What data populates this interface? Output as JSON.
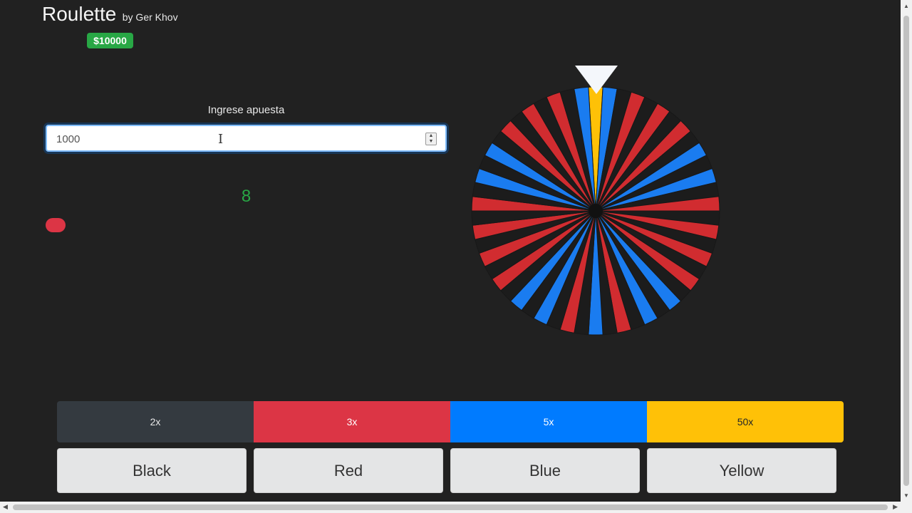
{
  "app": {
    "title": "Roulette",
    "byline": "by Ger Khov",
    "balance": "$10000"
  },
  "bet": {
    "label": "Ingrese apuesta",
    "value": "1000"
  },
  "result": {
    "number": "8"
  },
  "wheel": {
    "segments": 54,
    "colors": {
      "black": "#1c1c1c",
      "red": "#d12c30",
      "blue": "#1a7cf0",
      "yellow": "#fec107"
    }
  },
  "payouts": [
    {
      "label": "2x",
      "color": "#343a40"
    },
    {
      "label": "3x",
      "color": "#dc3545"
    },
    {
      "label": "5x",
      "color": "#007bff"
    },
    {
      "label": "50x",
      "color": "#ffc107"
    }
  ],
  "buttons": {
    "black": "Black",
    "red": "Red",
    "blue": "Blue",
    "yellow": "Yellow"
  }
}
